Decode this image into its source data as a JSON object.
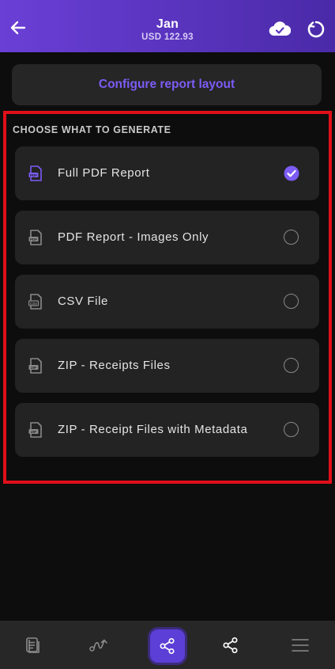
{
  "header": {
    "title": "Jan",
    "subtitle": "USD 122.93",
    "back_icon": "arrow-left-icon",
    "cloud_icon": "cloud-check-icon",
    "sync_icon": "sync-icon",
    "gradient_start": "#6a3fd6",
    "gradient_end": "#4a2aa8"
  },
  "configure": {
    "label": "Configure report layout",
    "color": "#7c5cf5"
  },
  "section": {
    "label": "CHOOSE WHAT TO GENERATE"
  },
  "options": [
    {
      "label": "Full PDF Report",
      "icon": "pdf-file-icon",
      "selected": true
    },
    {
      "label": "PDF Report - Images Only",
      "icon": "pdf-file-icon",
      "selected": false
    },
    {
      "label": "CSV File",
      "icon": "csv-file-icon",
      "selected": false
    },
    {
      "label": "ZIP - Receipts Files",
      "icon": "zip-file-icon",
      "selected": false
    },
    {
      "label": "ZIP - Receipt Files with Metadata",
      "icon": "zip-file-icon",
      "selected": false
    }
  ],
  "bottom_nav": [
    {
      "name": "receipts",
      "icon": "receipt-icon",
      "active": false
    },
    {
      "name": "trips",
      "icon": "route-icon",
      "active": false
    },
    {
      "name": "generate",
      "icon": "share-icon",
      "active": true
    },
    {
      "name": "share",
      "icon": "share-icon",
      "active": false
    },
    {
      "name": "menu",
      "icon": "menu-icon",
      "active": false
    }
  ],
  "colors": {
    "accent": "#7c5cf5",
    "highlight": "#e10f1a"
  }
}
